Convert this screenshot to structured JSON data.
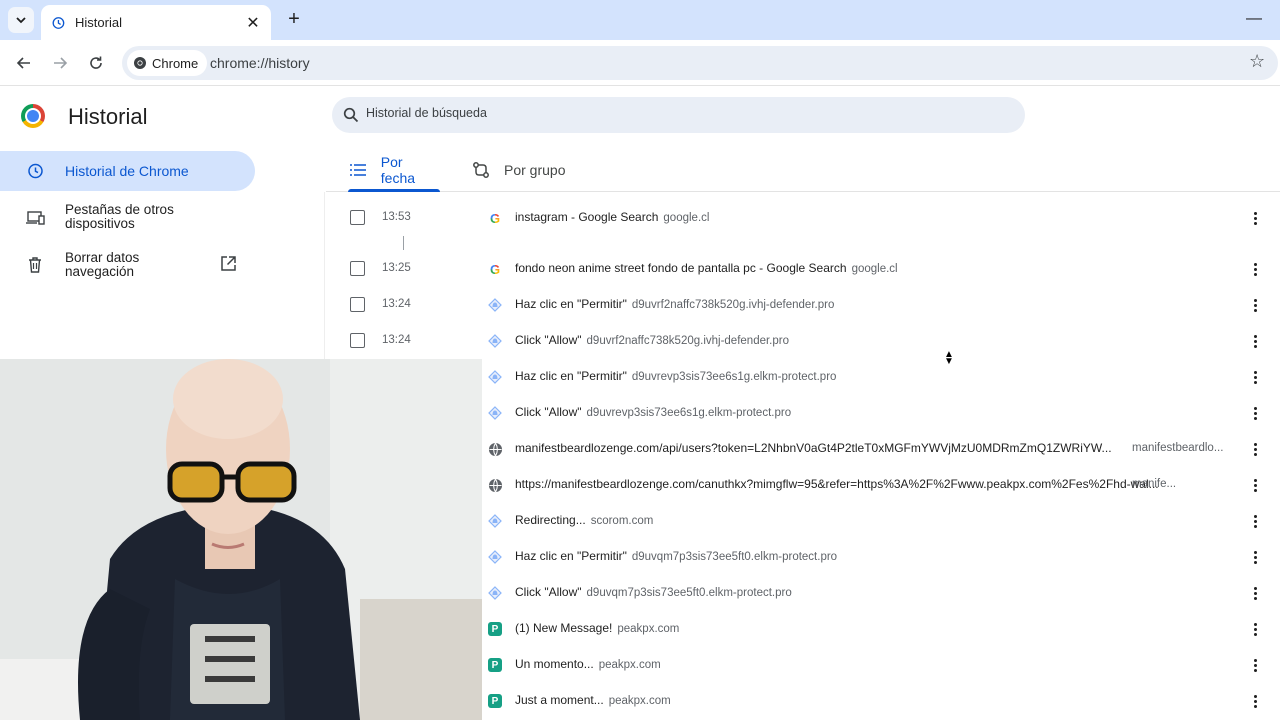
{
  "browser": {
    "tab_title": "Historial",
    "omnibox_chip": "Chrome",
    "url": "chrome://history"
  },
  "sidebar": {
    "title": "Historial",
    "items": [
      {
        "label": "Historial de Chrome",
        "icon": "history-icon"
      },
      {
        "label": "Pestañas de otros dispositivos",
        "icon": "devices-icon"
      },
      {
        "label": "Borrar datos navegación",
        "icon": "trash-icon"
      }
    ]
  },
  "main": {
    "search_placeholder": "Historial de búsqueda",
    "tabs": [
      {
        "label": "Por fecha",
        "icon": "list-icon",
        "selected": true
      },
      {
        "label": "Por grupo",
        "icon": "group-icon",
        "selected": false
      }
    ]
  },
  "history": [
    {
      "time": "13:53",
      "favicon": "google",
      "title": "instagram - Google Search",
      "domain": "google.cl"
    },
    {
      "time": "13:25",
      "favicon": "google",
      "title": "fondo neon anime street fondo de pantalla pc - Google Search",
      "domain": "google.cl"
    },
    {
      "time": "13:24",
      "favicon": "bell",
      "title": "Haz clic en \"Permitir\"",
      "domain": "d9uvrf2naffc738k520g.ivhj-defender.pro"
    },
    {
      "time": "13:24",
      "favicon": "bell",
      "title": "Click \"Allow\"",
      "domain": "d9uvrf2naffc738k520g.ivhj-defender.pro"
    },
    {
      "time": "",
      "favicon": "bell",
      "title": "Haz clic en \"Permitir\"",
      "domain": "d9uvrevp3sis73ee6s1g.elkm-protect.pro"
    },
    {
      "time": "",
      "favicon": "bell",
      "title": "Click \"Allow\"",
      "domain": "d9uvrevp3sis73ee6s1g.elkm-protect.pro"
    },
    {
      "time": "",
      "favicon": "globe",
      "title": "manifestbeardlozenge.com/api/users?token=L2NhbnV0aGt4P2tleT0xMGFmYWVjMzU0MDRmZmQ1ZWRiYW...",
      "domain_right": "manifestbeardlo..."
    },
    {
      "time": "",
      "favicon": "globe",
      "title": "https://manifestbeardlozenge.com/canuthkx?mimgflw=95&refer=https%3A%2F%2Fwww.peakpx.com%2Fes%2Fhd-wal...",
      "domain_right": "manife..."
    },
    {
      "time": "",
      "favicon": "bell",
      "title": "Redirecting...",
      "domain": "scorom.com"
    },
    {
      "time": "",
      "favicon": "bell",
      "title": "Haz clic en \"Permitir\"",
      "domain": "d9uvqm7p3sis73ee5ft0.elkm-protect.pro"
    },
    {
      "time": "",
      "favicon": "bell",
      "title": "Click \"Allow\"",
      "domain": "d9uvqm7p3sis73ee5ft0.elkm-protect.pro"
    },
    {
      "time": "",
      "favicon": "peakpx",
      "title": "(1) New Message!",
      "domain": "peakpx.com"
    },
    {
      "time": "",
      "favicon": "peakpx",
      "title": "Un momento...",
      "domain": "peakpx.com"
    },
    {
      "time": "",
      "favicon": "peakpx",
      "title": "Just a moment...",
      "domain": "peakpx.com"
    }
  ],
  "colors": {
    "accent": "#0b57d0",
    "tabstrip": "#d3e3fd",
    "omnibox": "#e9eef6"
  }
}
